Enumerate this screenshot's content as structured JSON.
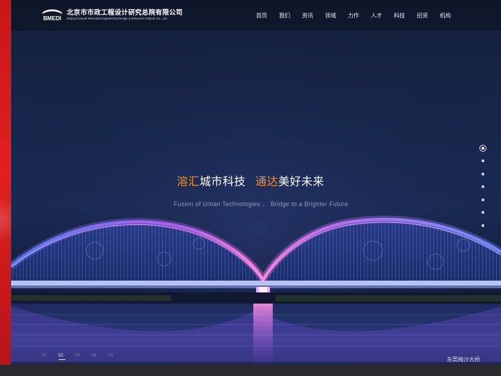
{
  "brand": {
    "logo_mark": "BMEDI",
    "name_cn": "北京市市政工程设计研究总院有限公司",
    "name_en": "Beijing General Municipal Engineering Design & Research Institute Co., Ltd."
  },
  "nav": {
    "items": [
      "首页",
      "我们",
      "资讯",
      "领域",
      "力作",
      "人才",
      "科技",
      "招贤",
      "机构"
    ]
  },
  "hero": {
    "headline": {
      "part1_accent": "溶汇",
      "part1_rest": "城市科技",
      "part2_accent": "通达",
      "part2_rest": "美好未来"
    },
    "subline": "Fusion of Urban Technologies ， Bridge to a Brighter Future",
    "caption": "东莞梅沙大桥"
  },
  "pager": {
    "items": [
      "01",
      "02",
      "03",
      "04",
      "05"
    ],
    "active_index": 1
  },
  "side_dots": {
    "count": 7,
    "active_index": 0
  },
  "colors": {
    "accent": "#f5922a",
    "red_bar": "#e11f1f",
    "header_bg": "#0f1628",
    "arch_glow": "#b85cf5"
  },
  "icons": {
    "logo": "bmedi-logo-icon"
  }
}
